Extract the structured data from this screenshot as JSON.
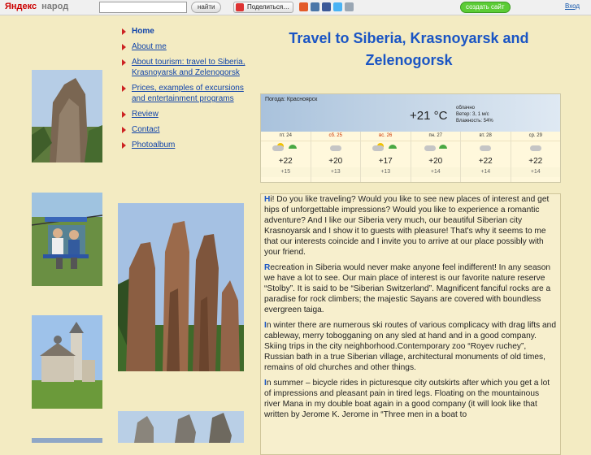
{
  "topbar": {
    "logo_ya": "Яндекс",
    "logo_narod": "народ",
    "search_placeholder": "",
    "find_label": "найти",
    "share_label": "Поделиться…",
    "create_label": "создать сайт",
    "login_label": "Вход"
  },
  "nav": {
    "items": [
      {
        "label": "Home"
      },
      {
        "label": "About me"
      },
      {
        "label": "About tourism: travel to Siberia, Krasnoyarsk and Zelenogorsk"
      },
      {
        "label": "Prices, examples of excursions and entertainment programs"
      },
      {
        "label": "Review"
      },
      {
        "label": "Contact"
      },
      {
        "label": "Photoalbum"
      }
    ]
  },
  "title": "Travel to Siberia, Krasnoyarsk and Zelenogorsk",
  "weather": {
    "location": "Погода: Красноярск",
    "current_temp": "+21 °C",
    "condition": "облачно",
    "wind": "Ветер: З, 1 м/с",
    "humidity": "Влажность: 54%",
    "days": [
      {
        "label": "пт. 24",
        "weekend": false,
        "hi": "+22",
        "lo": "+15"
      },
      {
        "label": "сб. 25",
        "weekend": true,
        "hi": "+20",
        "lo": "+13"
      },
      {
        "label": "вс. 26",
        "weekend": true,
        "hi": "+17",
        "lo": "+13"
      },
      {
        "label": "пн. 27",
        "weekend": false,
        "hi": "+20",
        "lo": "+14"
      },
      {
        "label": "вт. 28",
        "weekend": false,
        "hi": "+22",
        "lo": "+14"
      },
      {
        "label": "ср. 29",
        "weekend": false,
        "hi": "+22",
        "lo": "+14"
      }
    ]
  },
  "content": {
    "paragraphs": [
      {
        "first": "H",
        "rest": "i! Do you like traveling? Would you like to see new places of interest and get hips of unforgettable impressions? Would you like to experience a romantic adventure? And I like our Siberia very much, our beautiful Siberian city Krasnoyarsk and I show it to guests with pleasure! That's why it seems to me that our interests coincide and I invite you to arrive at our place possibly with your friend."
      },
      {
        "first": "R",
        "rest": "ecreation in Siberia would never make anyone feel indifferent! In any season we have a lot to see. Our main place of interest is our favorite nature reserve “Stolby”. It is said to be “Siberian Switzerland”. Magnificent fanciful rocks are a paradise for rock climbers; the majestic Sayans are covered with boundless evergreen taiga."
      },
      {
        "first": "I",
        "rest": "n winter there are numerous ski routes of various complicacy with drag lifts and cableway, merry tobogganing on any sled at hand and in a good company. Skiing trips in the city neighborhood.Contemporary zoo “Royev ruchey”, Russian bath in a true Siberian village, architectural monuments of old times, remains of old churches and other things."
      },
      {
        "first": "I",
        "rest": "n summer – bicycle rides in picturesque city outskirts after which you get a lot of impressions and pleasant pain in tired legs. Floating on the mountainous river Mana in my double boat again in a good company (it will look like that written by Jerome K. Jerome in “Three men in a boat to"
      }
    ]
  },
  "colors": {
    "background": "#f3ebc2",
    "link": "#1144aa",
    "title": "#1a55c4",
    "bullet": "#cc2222"
  }
}
